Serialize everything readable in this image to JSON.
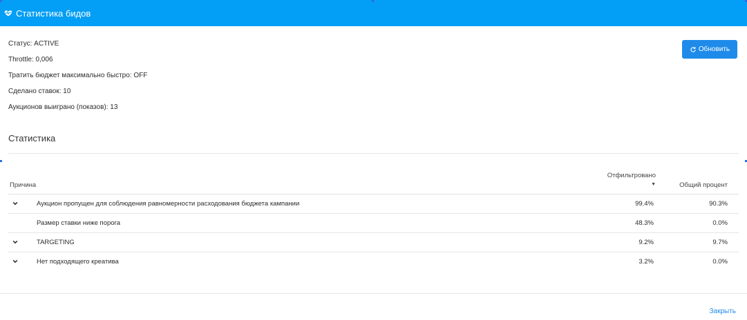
{
  "modal": {
    "title": "Статистика бидов",
    "header_icon": "heart-pulse-icon",
    "accent_color": "#039ef5"
  },
  "info": {
    "status": "Статус: ACTIVE",
    "throttle": "Throttle: 0,006",
    "spend_fast": "Тратить бюджет максимально быстро: OFF",
    "bids_made": "Сделано ставок: 10",
    "auctions_won": "Аукционов выиграно (показов): 13"
  },
  "refresh_button": {
    "label": "Обновить",
    "icon": "refresh-icon"
  },
  "stats": {
    "title": "Статистика",
    "columns": {
      "reason": "Причина",
      "filtered": "Отфильтровано",
      "total": "Общий процент"
    },
    "sort_indicator": "▼",
    "rows": [
      {
        "expandable": true,
        "reason": "Аукцион пропущен для соблюдения равномерности расходования бюджета кампании",
        "filtered": "99.4%",
        "total": "90.3%"
      },
      {
        "expandable": false,
        "reason": "Размер ставки ниже порога",
        "filtered": "48.3%",
        "total": "0.0%"
      },
      {
        "expandable": true,
        "reason": "TARGETING",
        "filtered": "9.2%",
        "total": "9.7%"
      },
      {
        "expandable": true,
        "reason": "Нет подходящего креатива",
        "filtered": "3.2%",
        "total": "0.0%"
      }
    ]
  },
  "footer": {
    "close_label": "Закрыть"
  }
}
